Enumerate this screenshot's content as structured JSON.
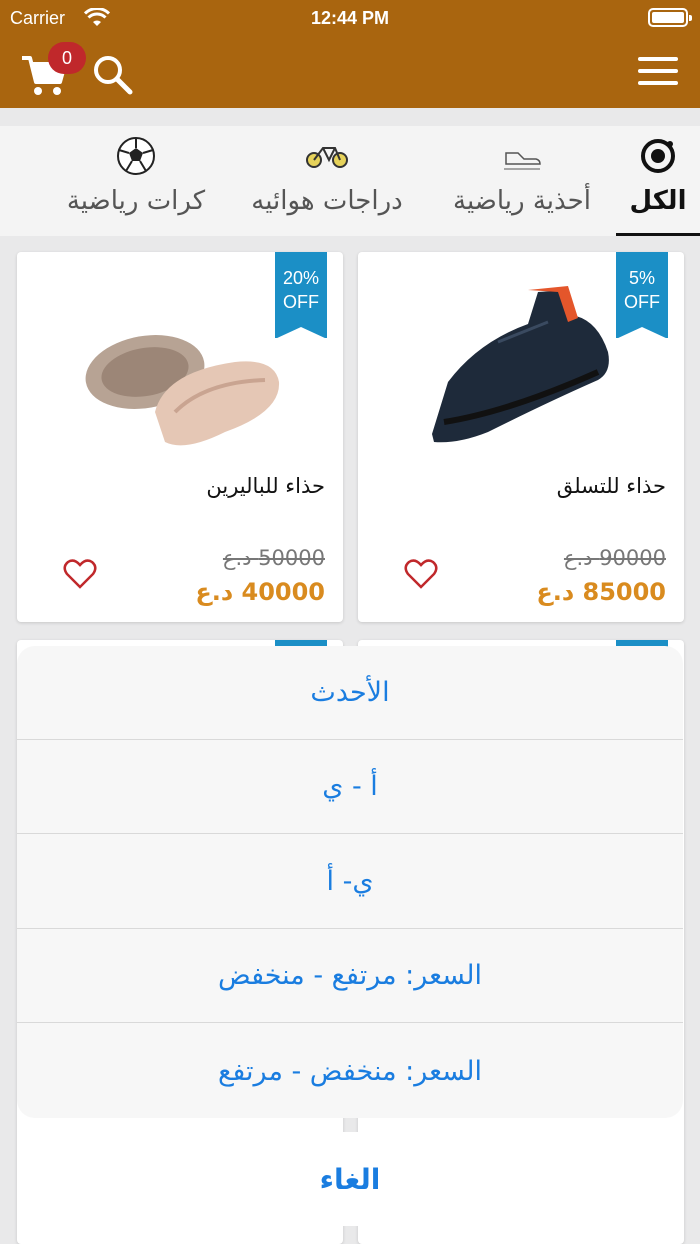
{
  "status_bar": {
    "carrier": "Carrier",
    "time": "12:44 PM"
  },
  "nav": {
    "cart_count": "0",
    "colors": {
      "bar": "#a9650f",
      "badge": "#c0282b"
    }
  },
  "tabs": [
    {
      "label": "الكل",
      "icon": "ionic-logo-icon",
      "active": true
    },
    {
      "label": "أحذية رياضية",
      "icon": "shoe-icon",
      "active": false
    },
    {
      "label": "دراجات هوائيه",
      "icon": "bicycle-icon",
      "active": false
    },
    {
      "label": "كرات رياضية",
      "icon": "soccer-ball-icon",
      "active": false
    }
  ],
  "products": [
    {
      "name": "حذاء للتسلق",
      "discount_line1": "5%",
      "discount_line2": "OFF",
      "old_price": "90000 د.ع",
      "new_price": "85000 د.ع",
      "image": "climbing-shoe"
    },
    {
      "name": "حذاء للباليرين",
      "discount_line1": "20%",
      "discount_line2": "OFF",
      "old_price": "50000 د.ع",
      "new_price": "40000 د.ع",
      "image": "ballerina-shoes"
    }
  ],
  "sort_sheet": {
    "options": [
      "الأحدث",
      "أ - ي",
      "ي- أ",
      "السعر: مرتفع - منخفض",
      "السعر: منخفض - مرتفع"
    ],
    "cancel_label": "الغاء",
    "accent_color": "#1a7de0"
  },
  "colors": {
    "discount_ribbon": "#1b8fc6",
    "price": "#d98b1f"
  }
}
